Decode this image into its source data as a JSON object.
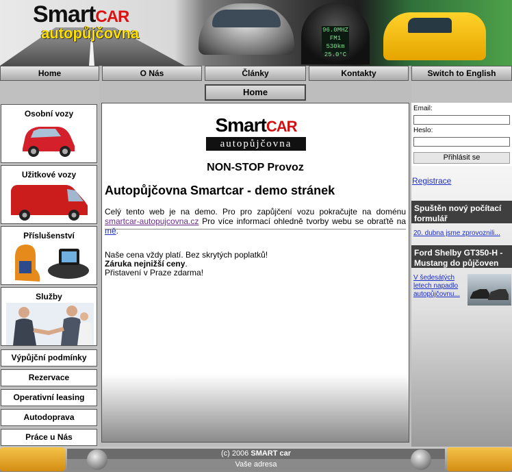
{
  "header": {
    "logo_smart": "Smart",
    "logo_car": "CAR",
    "logo_sub": "autopůjčovna",
    "dash_lines": [
      "96.0MHZ",
      "FM1",
      "530km",
      "25.0°C"
    ]
  },
  "nav": {
    "items": [
      "Home",
      "O Nás",
      "Články",
      "Kontakty",
      "Switch to English"
    ],
    "current": "Home"
  },
  "left": {
    "cards": [
      "Osobní vozy",
      "Užitkové vozy",
      "Příslušenství",
      "Služby"
    ],
    "buttons": [
      "Výpůjční podmínky",
      "Rezervace",
      "Operativní leasing",
      "Autodoprava",
      "Práce u Nás"
    ]
  },
  "main": {
    "logo_smart": "Smart",
    "logo_car": "CAR",
    "logo_sub": "autopůjčovna",
    "tagline": "NON-STOP Provoz",
    "heading": "Autopůjčovna Smartcar - demo stránek",
    "intro_a": "Celý tento web je na demo. Pro pro zapůjčení vozu pokračujte na doménu ",
    "intro_link": "smartcar-autopujcovna.cz",
    "intro_b": " Pro více informací ohledně tvorby webu se obraťtě na ",
    "intro_link2": "mě",
    "intro_c": ".",
    "line1": "Naše cena vždy platí. Bez skrytých poplatků!",
    "line2_bold": "Záruka nejnižší ceny",
    "line2_end": ".",
    "line3": "Přistavení v Praze zdarma!"
  },
  "login": {
    "email_label": "Email:",
    "email_value": "",
    "password_label": "Heslo:",
    "password_value": "",
    "submit": "Přihlásit se",
    "register": "Registrace"
  },
  "news": [
    {
      "title": "Spuštěn nový počítací formulář",
      "link": "20. dubna jsme zprovoznili..."
    },
    {
      "title": "Ford Shelby GT350-H - Mustang do půjčoven",
      "link": "V šedesátých letech napadlo autopůjčovnu..."
    }
  ],
  "footer": {
    "copyright_pre": "(c) 2006 ",
    "copyright_bold": "SMART car",
    "address": "Vaše adresa"
  },
  "colors": {
    "accent_red": "#d11111",
    "link": "#1a2cc9",
    "header_dark": "#3f3f3f",
    "footer_orange": "#e8a42a"
  }
}
